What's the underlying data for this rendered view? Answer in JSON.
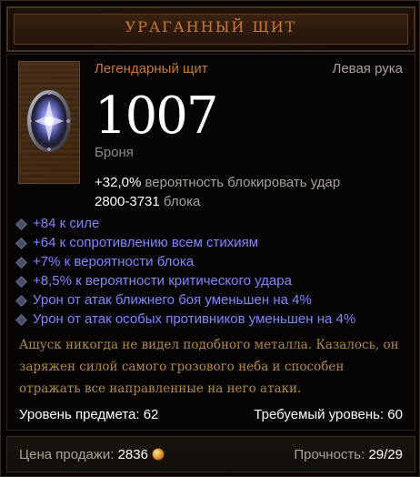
{
  "item": {
    "name": "УРАГАННЫЙ ЩИТ",
    "type": "Легендарный щит",
    "slot": "Левая рука",
    "armor_value": "1007",
    "armor_label": "Броня",
    "block_chance_value": "+32,0%",
    "block_chance_label": "вероятность блокировать удар",
    "block_amount_value": "2800-3731",
    "block_amount_label": "блока",
    "icon": "storm-shield-icon"
  },
  "affixes": [
    "+84 к силе",
    "+64 к сопротивлению всем стихиям",
    "+7% к вероятности блока",
    "+8,5% к вероятности критического удара",
    "Урон от атак ближнего боя уменьшен на 4%",
    "Урон от атак особых противников уменьшен на 4%"
  ],
  "flavor": {
    "lines": [
      "Ашуск никогда не видел подобного металла. Казалось, он",
      "заряжен силой самого грозового неба и способен",
      "отражать все направленные на него атаки."
    ]
  },
  "requirements": {
    "item_level_label": "Уровень предмета: 62",
    "required_level_label": "Требуемый уровень: 60"
  },
  "footer": {
    "sell_price_label": "Цена продажи:",
    "sell_price_value": "2836",
    "currency_icon": "gold-coin-icon",
    "durability_label": "Прочность:",
    "durability_value": "29/29"
  },
  "colors": {
    "legendary": "#c9792f",
    "affix": "#7f86ff",
    "flavor": "#b3883f"
  }
}
